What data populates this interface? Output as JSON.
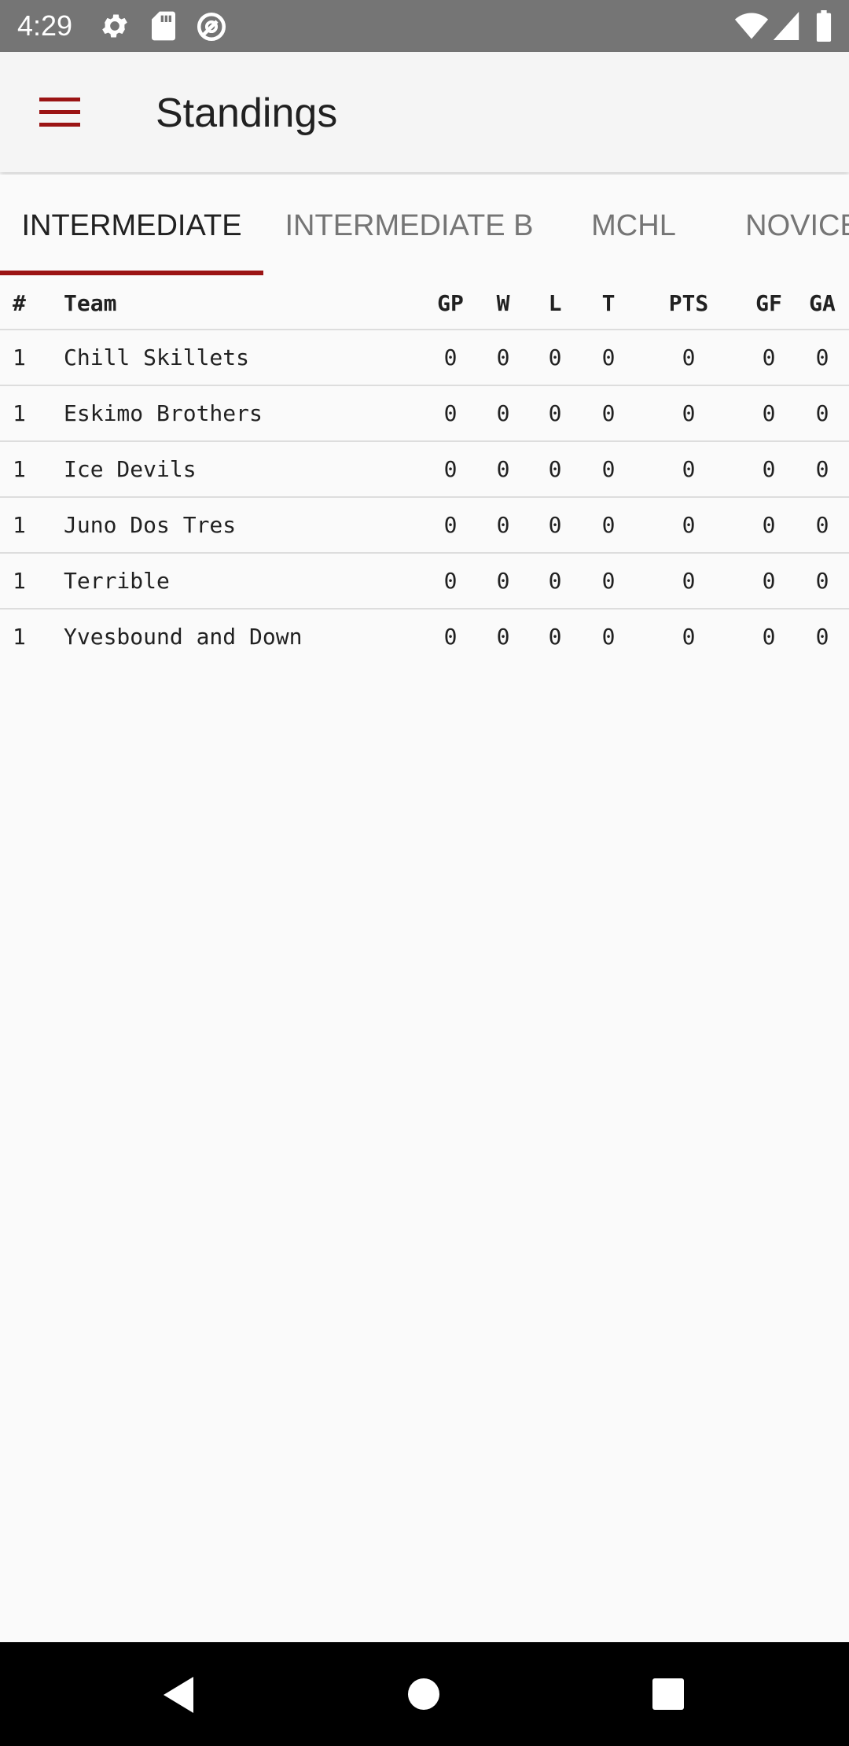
{
  "status_bar": {
    "time": "4:29",
    "icons": [
      "settings-icon",
      "sd-card-icon",
      "sync-icon",
      "wifi-icon",
      "signal-icon",
      "battery-icon"
    ]
  },
  "app_bar": {
    "title": "Standings",
    "menu_icon": "menu-icon",
    "accent_color": "#9b1414"
  },
  "tabs": [
    {
      "label": "INTERMEDIATE",
      "active": true
    },
    {
      "label": "INTERMEDIATE B",
      "active": false
    },
    {
      "label": "MCHL",
      "active": false
    },
    {
      "label": "NOVICE",
      "active": false
    }
  ],
  "table": {
    "headers": {
      "rank": "#",
      "team": "Team",
      "gp": "GP",
      "w": "W",
      "l": "L",
      "t": "T",
      "pts": "PTS",
      "gf": "GF",
      "ga": "GA"
    },
    "rows": [
      {
        "rank": "1",
        "team": "Chill Skillets",
        "gp": "0",
        "w": "0",
        "l": "0",
        "t": "0",
        "pts": "0",
        "gf": "0",
        "ga": "0"
      },
      {
        "rank": "1",
        "team": "Eskimo Brothers",
        "gp": "0",
        "w": "0",
        "l": "0",
        "t": "0",
        "pts": "0",
        "gf": "0",
        "ga": "0"
      },
      {
        "rank": "1",
        "team": "Ice Devils",
        "gp": "0",
        "w": "0",
        "l": "0",
        "t": "0",
        "pts": "0",
        "gf": "0",
        "ga": "0"
      },
      {
        "rank": "1",
        "team": "Juno Dos Tres",
        "gp": "0",
        "w": "0",
        "l": "0",
        "t": "0",
        "pts": "0",
        "gf": "0",
        "ga": "0"
      },
      {
        "rank": "1",
        "team": "Terrible",
        "gp": "0",
        "w": "0",
        "l": "0",
        "t": "0",
        "pts": "0",
        "gf": "0",
        "ga": "0"
      },
      {
        "rank": "1",
        "team": "Yvesbound and Down",
        "gp": "0",
        "w": "0",
        "l": "0",
        "t": "0",
        "pts": "0",
        "gf": "0",
        "ga": "0"
      }
    ]
  },
  "nav_bar": {
    "icons": [
      "back-icon",
      "home-icon",
      "recents-icon"
    ]
  }
}
